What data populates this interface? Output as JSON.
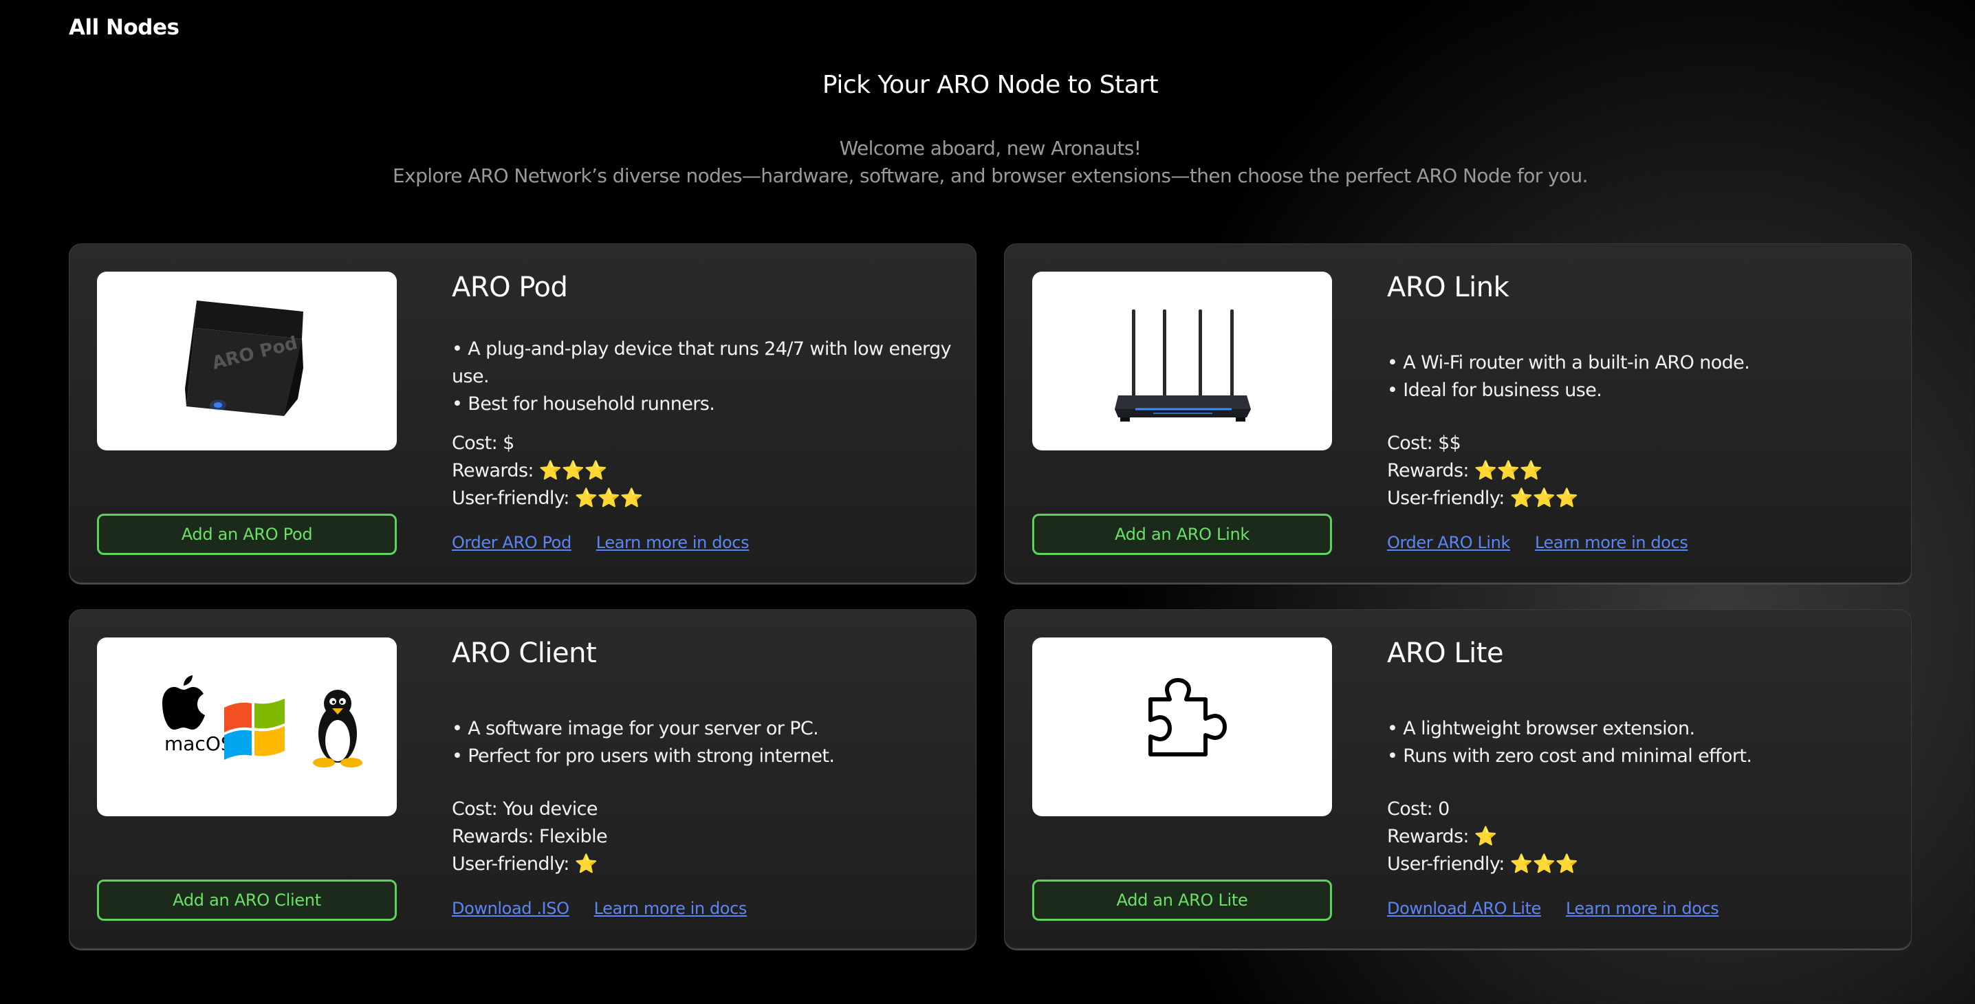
{
  "breadcrumb": "All Nodes",
  "page_title": "Pick Your ARO Node to Start",
  "subtitle_line1": "Welcome aboard, new Aronauts!",
  "subtitle_line2": "Explore ARO Network’s diverse nodes—hardware, software, and browser extensions—then choose the perfect ARO Node for you.",
  "colors": {
    "accent_green": "#5ed35a",
    "link_blue": "#5d86f5",
    "star_gold": "#f4c21b"
  },
  "cards": [
    {
      "name": "ARO Pod",
      "image_icon": "aro-pod-device-icon",
      "image_brand_text": "ARO Pod",
      "bullets": [
        "• A plug-and-play device that runs 24/7 with low energy use.",
        "• Best for household runners."
      ],
      "cost": "Cost: $",
      "rewards": "Rewards: ⭐⭐⭐",
      "user_friendly": "User-friendly: ⭐⭐⭐",
      "add_button": "Add an ARO Pod",
      "link1": "Order ARO Pod",
      "link2": "Learn more in docs"
    },
    {
      "name": "ARO Link",
      "image_icon": "wifi-router-icon",
      "bullets": [
        "• A Wi-Fi router with a built-in ARO node.",
        "• Ideal for business use."
      ],
      "cost": "Cost: $$",
      "rewards": "Rewards: ⭐⭐⭐",
      "user_friendly": "User-friendly: ⭐⭐⭐",
      "add_button": "Add an ARO Link",
      "link1": "Order ARO Link",
      "link2": "Learn more in docs"
    },
    {
      "name": "ARO Client",
      "image_icon": "os-logos-icon",
      "image_os_label": "macOS",
      "bullets": [
        "• A software image for your server or PC.",
        "• Perfect for pro users with strong internet."
      ],
      "cost": "Cost: You device",
      "rewards": "Rewards: Flexible",
      "user_friendly": "User-friendly: ⭐",
      "add_button": "Add an ARO Client",
      "link1": "Download .ISO",
      "link2": "Learn more in docs"
    },
    {
      "name": "ARO Lite",
      "image_icon": "puzzle-piece-icon",
      "bullets": [
        "• A lightweight browser extension.",
        "• Runs with zero cost and minimal effort."
      ],
      "cost": "Cost: 0",
      "rewards": "Rewards: ⭐",
      "user_friendly": "User-friendly: ⭐⭐⭐",
      "add_button": "Add an ARO Lite",
      "link1": "Download ARO Lite",
      "link2": "Learn more in docs"
    }
  ]
}
